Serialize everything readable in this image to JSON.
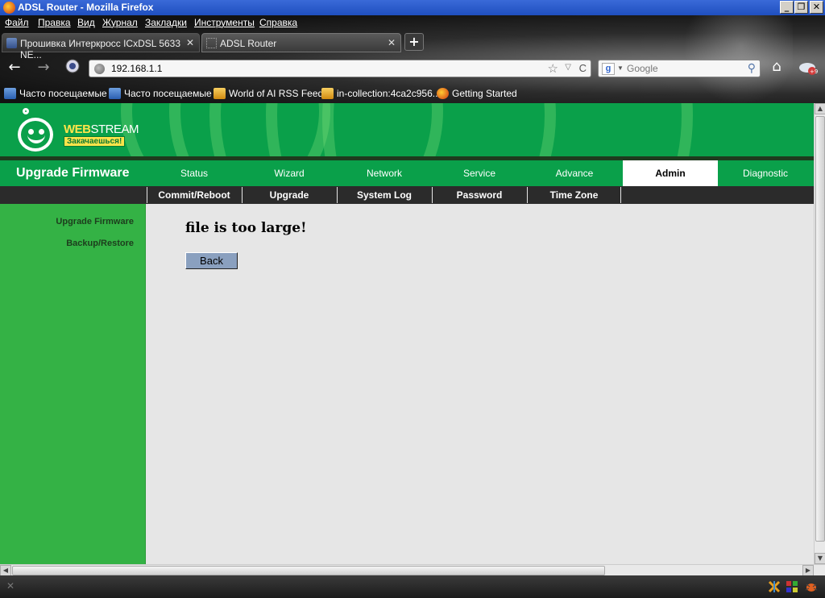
{
  "window": {
    "title": "ADSL Router - Mozilla Firefox",
    "controls": {
      "minimize": "_",
      "maximize": "❐",
      "close": "✕"
    }
  },
  "menu": [
    "Файл",
    "Правка",
    "Вид",
    "Журнал",
    "Закладки",
    "Инструменты",
    "Справка"
  ],
  "tabs": [
    {
      "label": "Прошивка Интеркросс ICxDSL 5633 NE...",
      "close": "✕"
    },
    {
      "label": "ADSL Router",
      "close": "✕"
    }
  ],
  "new_tab": "+",
  "nav": {
    "url": "192.168.1.1",
    "search_placeholder": "Google",
    "back": "←",
    "forward": "→",
    "reload": "C",
    "home": "⌂"
  },
  "bookmarks": [
    {
      "label": "Часто посещаемые",
      "icon": "blue"
    },
    {
      "label": "Часто посещаемые",
      "icon": "blue"
    },
    {
      "label": "World of AI RSS Feed",
      "icon": "rss"
    },
    {
      "label": "in-collection:4ca2c956...",
      "icon": "rss"
    },
    {
      "label": "Getting Started",
      "icon": "ff"
    }
  ],
  "router": {
    "brand_web": "WEB",
    "brand_stream": "STREAM",
    "tagline": "Закачаешься!",
    "section_title": "Upgrade Firmware",
    "main_nav": [
      "Status",
      "Wizard",
      "Network",
      "Service",
      "Advance",
      "Admin",
      "Diagnostic"
    ],
    "active_main": "Admin",
    "sub_nav": [
      "Commit/Reboot",
      "Upgrade",
      "System Log",
      "Password",
      "Time Zone"
    ],
    "sidebar": [
      "Upgrade Firmware",
      "Backup/Restore"
    ],
    "message": "file is too large!",
    "back_button": "Back"
  },
  "colors": {
    "router_green": "#0aa04a",
    "sidebar_green": "#34b245",
    "subnav_dark": "#2b2b2b",
    "button_blue": "#8aa0bf"
  }
}
